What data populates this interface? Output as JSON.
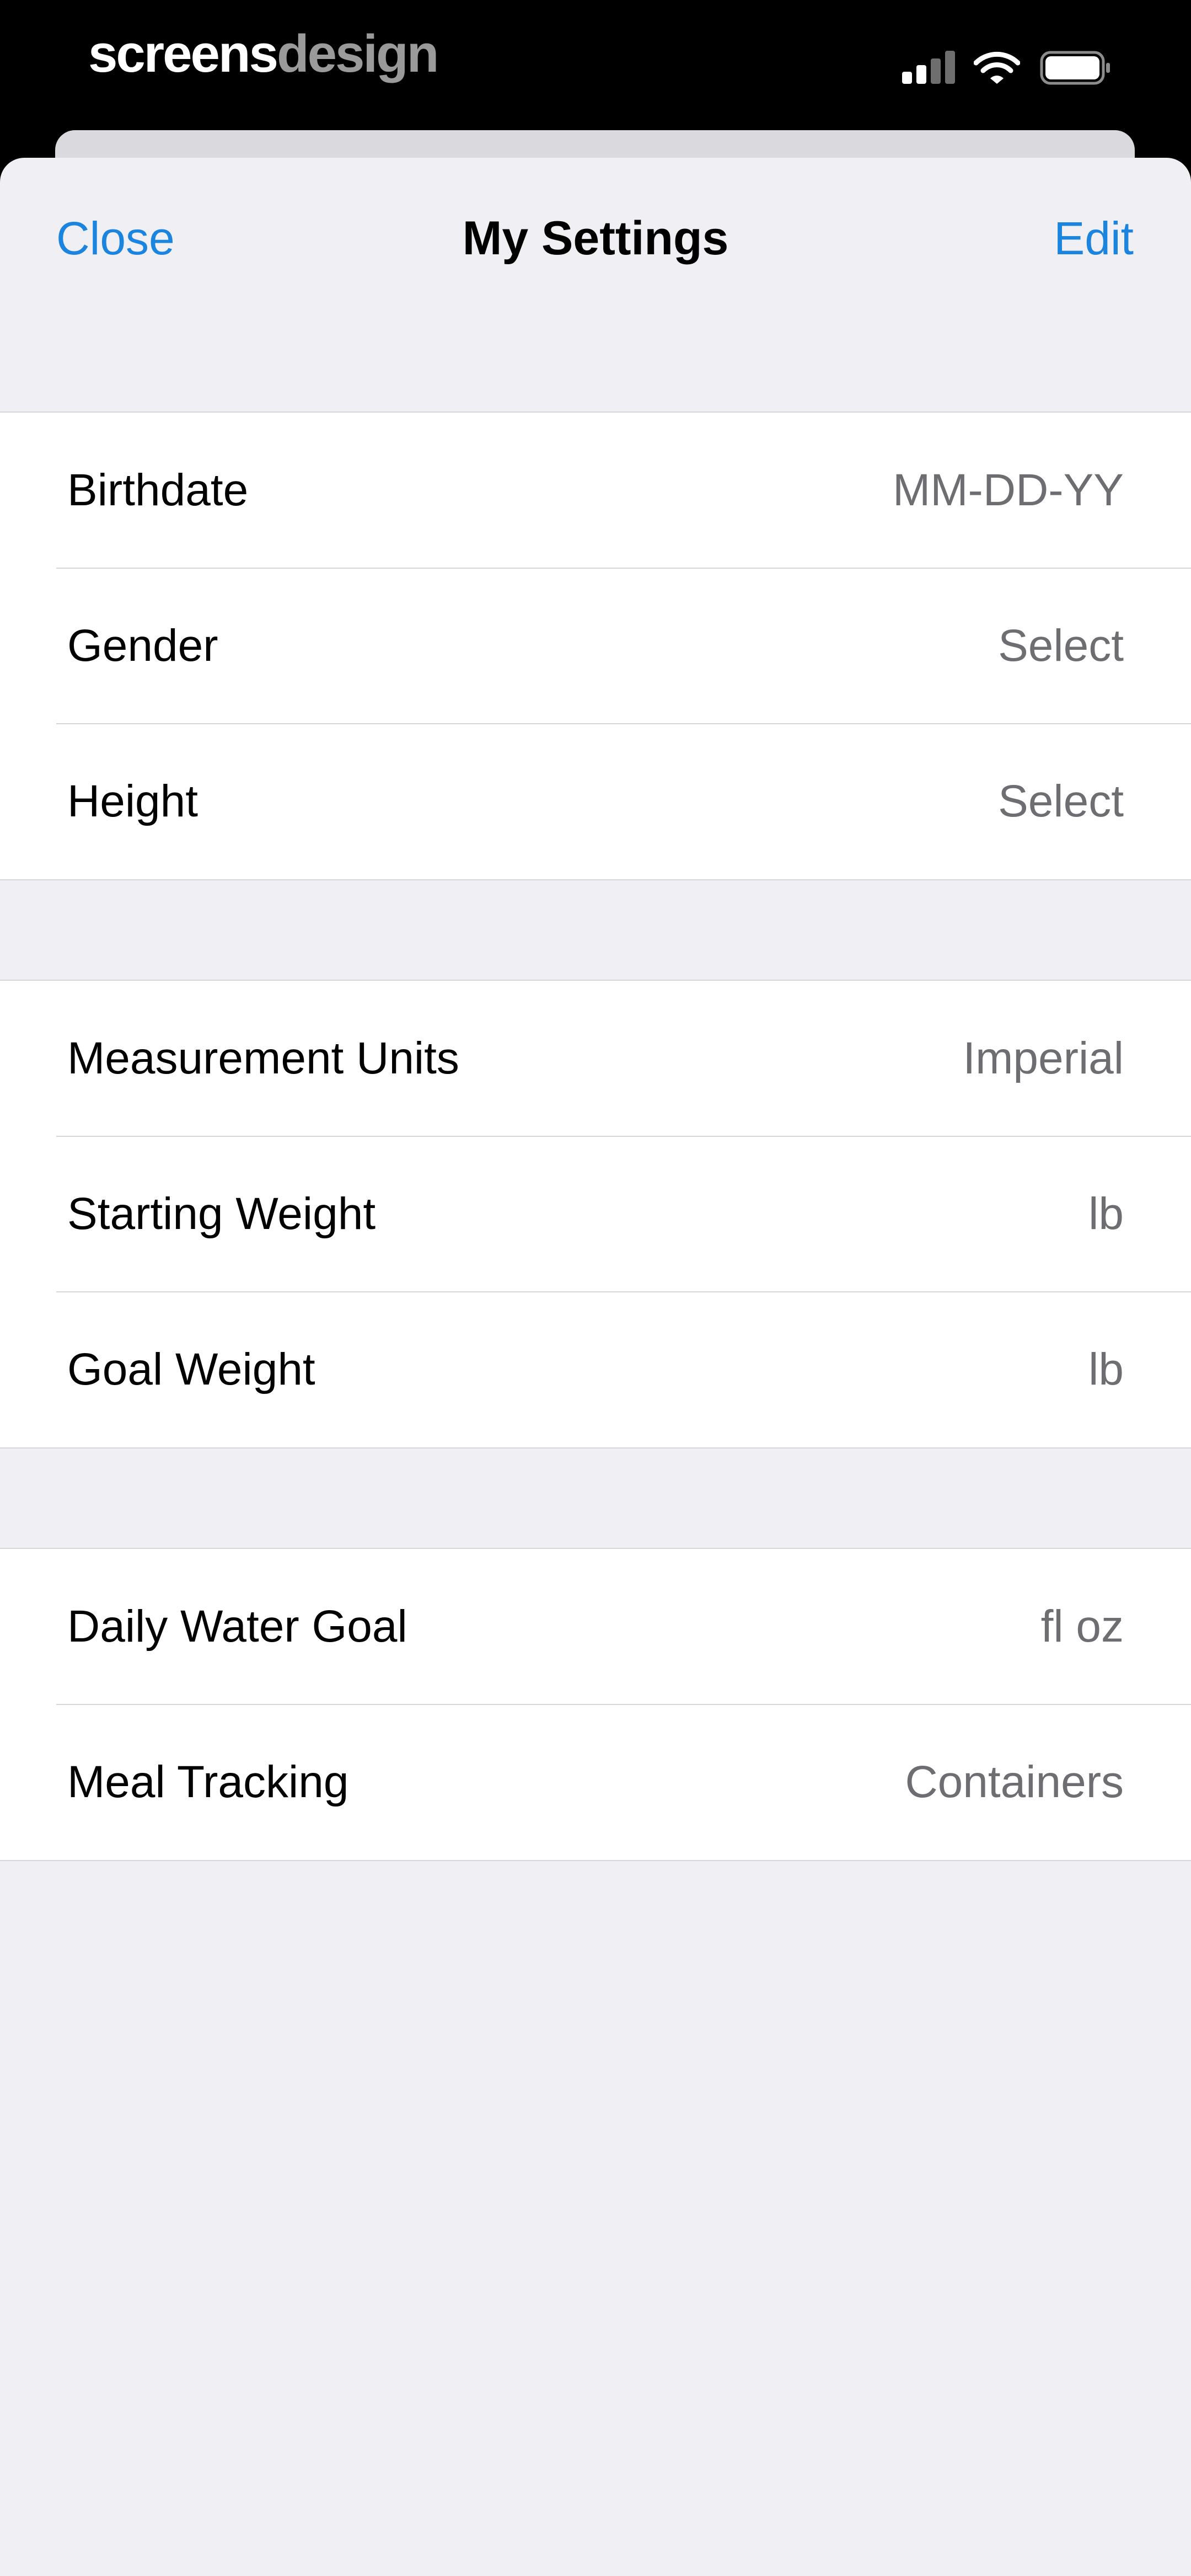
{
  "status_bar": {
    "brand_part1": "screens",
    "brand_part2": "design",
    "signal_icon": "cellular-signal-icon",
    "wifi_icon": "wifi-icon",
    "battery_icon": "battery-icon"
  },
  "nav": {
    "close_label": "Close",
    "title": "My Settings",
    "edit_label": "Edit"
  },
  "groups": [
    {
      "rows": [
        {
          "label": "Birthdate",
          "value": "MM-DD-YY"
        },
        {
          "label": "Gender",
          "value": "Select"
        },
        {
          "label": "Height",
          "value": "Select"
        }
      ]
    },
    {
      "rows": [
        {
          "label": "Measurement Units",
          "value": "Imperial"
        },
        {
          "label": "Starting Weight",
          "value": "lb"
        },
        {
          "label": "Goal Weight",
          "value": "lb"
        }
      ]
    },
    {
      "rows": [
        {
          "label": "Daily Water Goal",
          "value": "fl oz"
        },
        {
          "label": "Meal Tracking",
          "value": "Containers"
        }
      ]
    }
  ],
  "colors": {
    "accent": "#1a84df",
    "background": "#efeff4",
    "cell": "#ffffff",
    "value_text": "#6d6d72",
    "separator": "#d6d6da"
  }
}
